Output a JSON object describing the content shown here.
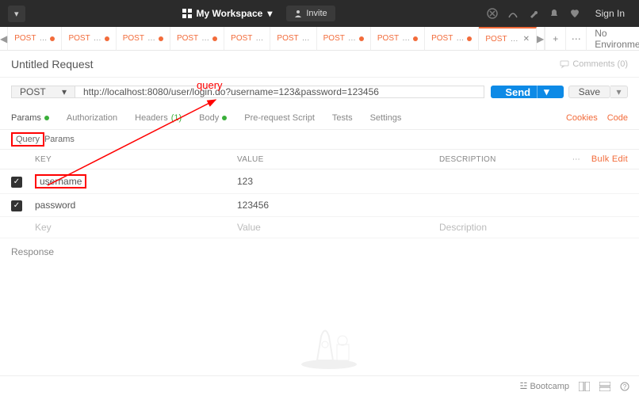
{
  "header": {
    "workspace_label": "My Workspace",
    "invite_label": "Invite",
    "signin_label": "Sign In"
  },
  "environment": {
    "selected": "No Environment"
  },
  "tabs": [
    {
      "method": "POST",
      "dot": true
    },
    {
      "method": "POST",
      "dot": true
    },
    {
      "method": "POST",
      "dot": true
    },
    {
      "method": "POST",
      "dot": true
    },
    {
      "method": "POST",
      "dot": false
    },
    {
      "method": "POST",
      "dot": false
    },
    {
      "method": "POST",
      "dot": true
    },
    {
      "method": "POST",
      "dot": true
    },
    {
      "method": "POST",
      "dot": true
    },
    {
      "method": "POST",
      "dot": false,
      "active": true,
      "close": true
    }
  ],
  "request": {
    "title": "Untitled Request",
    "comments_label": "Comments (0)",
    "method": "POST",
    "url": "http://localhost:8080/user/login.do?username=123&password=123456",
    "send_label": "Send",
    "save_label": "Save"
  },
  "req_tabs": {
    "params": "Params",
    "authorization": "Authorization",
    "headers": "Headers",
    "headers_count": "(1)",
    "body": "Body",
    "prerequest": "Pre-request Script",
    "tests": "Tests",
    "settings": "Settings",
    "cookies": "Cookies",
    "code": "Code"
  },
  "query_params": {
    "section_prefix": "Query",
    "section_suffix": "Params",
    "bulk_edit": "Bulk Edit",
    "headers": {
      "key": "KEY",
      "value": "VALUE",
      "description": "DESCRIPTION"
    },
    "rows": [
      {
        "checked": true,
        "key": "username",
        "value": "123",
        "description": "",
        "boxed": true
      },
      {
        "checked": true,
        "key": "password",
        "value": "123456",
        "description": ""
      }
    ],
    "placeholder": {
      "key": "Key",
      "value": "Value",
      "description": "Description"
    }
  },
  "response": {
    "label": "Response"
  },
  "annotation": {
    "label": "query"
  },
  "bottom": {
    "bootcamp": "Bootcamp"
  }
}
